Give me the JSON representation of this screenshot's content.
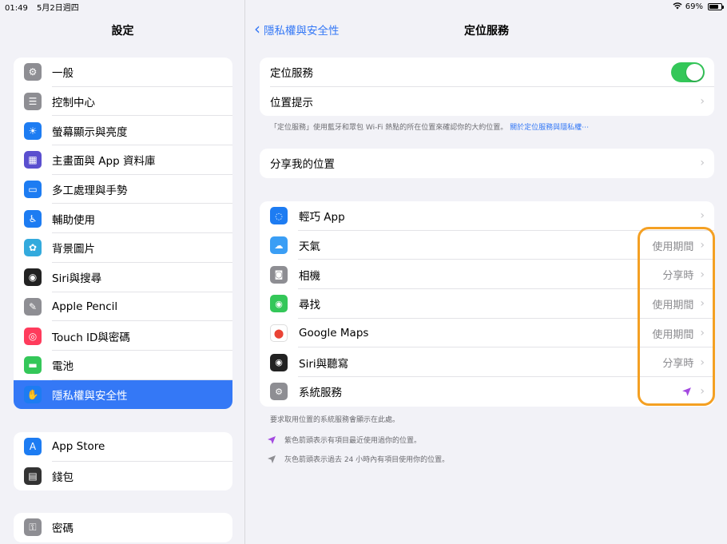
{
  "status": {
    "time": "01:49",
    "date": "5月2日週四",
    "battery": "69%"
  },
  "sidebar": {
    "title": "設定",
    "group1": [
      {
        "label": "一般",
        "icon": "gear-icon",
        "color": "#8e8e93"
      },
      {
        "label": "控制中心",
        "icon": "switches-icon",
        "color": "#8e8e93"
      },
      {
        "label": "螢幕顯示與亮度",
        "icon": "sun-icon",
        "color": "#1d7cf2"
      },
      {
        "label": "主畫面與 App 資料庫",
        "icon": "grid-icon",
        "color": "#5a4fcf"
      },
      {
        "label": "多工處理與手勢",
        "icon": "multitask-icon",
        "color": "#1d7cf2"
      },
      {
        "label": "輔助使用",
        "icon": "accessibility-icon",
        "color": "#1d7cf2"
      },
      {
        "label": "背景圖片",
        "icon": "flower-icon",
        "color": "#33aadd"
      },
      {
        "label": "Siri與搜尋",
        "icon": "siri-icon",
        "color": "#222"
      },
      {
        "label": "Apple Pencil",
        "icon": "pencil-icon",
        "color": "#8e8e93"
      },
      {
        "label": "Touch ID與密碼",
        "icon": "fingerprint-icon",
        "color": "#ff3b5c"
      },
      {
        "label": "電池",
        "icon": "battery-icon",
        "color": "#34c759"
      },
      {
        "label": "隱私權與安全性",
        "icon": "hand-icon",
        "color": "#1d7cf2",
        "active": true
      }
    ],
    "group2": [
      {
        "label": "App Store",
        "icon": "appstore-icon",
        "color": "#1d7cf2"
      },
      {
        "label": "錢包",
        "icon": "wallet-icon",
        "color": "#333"
      }
    ],
    "group3": [
      {
        "label": "密碼",
        "icon": "key-icon",
        "color": "#8e8e93"
      }
    ]
  },
  "nav": {
    "back": "隱私權與安全性",
    "title": "定位服務"
  },
  "location": {
    "toggle_label": "定位服務",
    "toggle_on": true,
    "alerts_label": "位置提示",
    "footnote": "「定位服務」使用藍牙和眾包 Wi-Fi 熱點的所在位置來確認你的大約位置。",
    "footnote_link": "關於定位服務與隱私權⋯",
    "share_label": "分享我的位置"
  },
  "apps": [
    {
      "label": "輕巧 App",
      "value": "",
      "icon": "appclip-icon",
      "color": "#1d7cf2"
    },
    {
      "label": "天氣",
      "value": "使用期間",
      "icon": "weather-icon",
      "color": "#3a9ef5"
    },
    {
      "label": "相機",
      "value": "分享時",
      "icon": "camera-icon",
      "color": "#8e8e93"
    },
    {
      "label": "尋找",
      "value": "使用期間",
      "icon": "findmy-icon",
      "color": "#34c759"
    },
    {
      "label": "Google Maps",
      "value": "使用期間",
      "icon": "googlemaps-icon",
      "color": "#ffffff"
    },
    {
      "label": "Siri與聽寫",
      "value": "分享時",
      "icon": "siri-icon",
      "color": "#222"
    },
    {
      "label": "系統服務",
      "value": "",
      "icon": "gear-icon",
      "color": "#8e8e93",
      "arrow": true
    }
  ],
  "notes": {
    "system": "要求取用位置的系統服務會顯示在此處。",
    "purple": "紫色箭頭表示有項目最近使用過你的位置。",
    "gray": "灰色箭頭表示過去 24 小時內有項目使用你的位置。"
  },
  "colors": {
    "accent": "#3478f6",
    "highlight": "#f4a023",
    "purple_arrow": "#a349e0",
    "gray_arrow": "#8e8e93"
  }
}
